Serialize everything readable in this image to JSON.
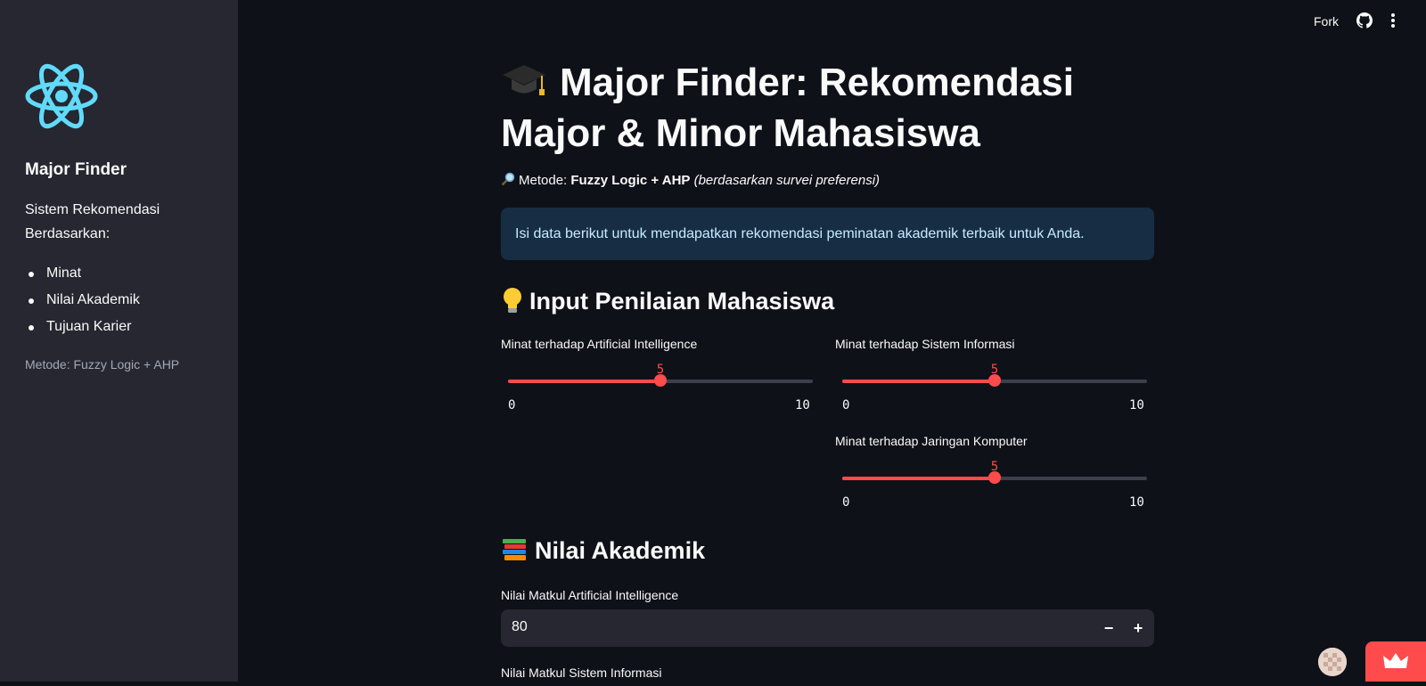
{
  "sidebar": {
    "title": "Major Finder",
    "description": "Sistem Rekomendasi Berdasarkan:",
    "items": [
      "Minat",
      "Nilai Akademik",
      "Tujuan Karier"
    ],
    "method": "Metode: Fuzzy Logic + AHP",
    "logo_icon": "react-atom-logo",
    "logo_color": "#61dafb"
  },
  "topbar": {
    "fork_label": "Fork",
    "github_icon": "github-icon",
    "menu_icon": "kebab-menu-icon"
  },
  "main": {
    "title": "Major Finder: Rekomendasi Major & Minor Mahasiswa",
    "title_icon": "graduation-cap-icon",
    "method_prefix": "Metode:",
    "method_bold": "Fuzzy Logic + AHP",
    "method_italic": "(berdasarkan survei preferensi)",
    "method_icon": "magnifier-icon",
    "info": "Isi data berikut untuk mendapatkan rekomendasi peminatan akademik terbaik untuk Anda."
  },
  "section_input": {
    "title": "Input Penilaian Mahasiswa",
    "icon": "lightbulb-icon",
    "sliders": [
      {
        "label": "Minat terhadap Artificial Intelligence",
        "value": 5,
        "min": 0,
        "max": 10
      },
      {
        "label": "Minat terhadap Sistem Informasi",
        "value": 5,
        "min": 0,
        "max": 10
      },
      {
        "label": "Minat terhadap Jaringan Komputer",
        "value": 5,
        "min": 0,
        "max": 10
      }
    ]
  },
  "section_nilai": {
    "title": "Nilai Akademik",
    "icon": "books-icon",
    "fields": [
      {
        "label": "Nilai Matkul Artificial Intelligence",
        "value": "80"
      },
      {
        "label": "Nilai Matkul Sistem Informasi"
      }
    ],
    "minus_label": "−",
    "plus_label": "+"
  },
  "colors": {
    "accent": "#ff4b4b",
    "background": "#0e1117",
    "sidebar": "#262730",
    "info_bg": "#172d43"
  }
}
